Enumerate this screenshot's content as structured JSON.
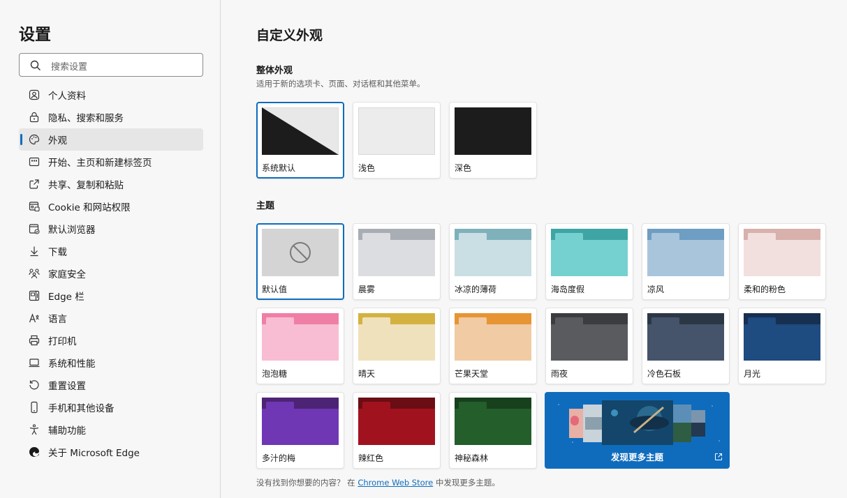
{
  "sidebar": {
    "title": "设置",
    "search_placeholder": "搜索设置",
    "items": [
      {
        "label": "个人资料",
        "icon": "profile-icon"
      },
      {
        "label": "隐私、搜索和服务",
        "icon": "lock-icon"
      },
      {
        "label": "外观",
        "icon": "palette-icon",
        "active": true
      },
      {
        "label": "开始、主页和新建标签页",
        "icon": "newtab-icon"
      },
      {
        "label": "共享、复制和粘贴",
        "icon": "share-icon"
      },
      {
        "label": "Cookie 和网站权限",
        "icon": "site-permissions-icon"
      },
      {
        "label": "默认浏览器",
        "icon": "default-browser-icon"
      },
      {
        "label": "下载",
        "icon": "download-icon"
      },
      {
        "label": "家庭安全",
        "icon": "family-icon"
      },
      {
        "label": "Edge 栏",
        "icon": "edge-bar-icon"
      },
      {
        "label": "语言",
        "icon": "language-icon"
      },
      {
        "label": "打印机",
        "icon": "printer-icon"
      },
      {
        "label": "系统和性能",
        "icon": "system-icon"
      },
      {
        "label": "重置设置",
        "icon": "reset-icon"
      },
      {
        "label": "手机和其他设备",
        "icon": "phone-icon"
      },
      {
        "label": "辅助功能",
        "icon": "accessibility-icon"
      },
      {
        "label": "关于 Microsoft Edge",
        "icon": "edge-logo-icon"
      }
    ]
  },
  "main": {
    "title": "自定义外观",
    "overall": {
      "heading": "整体外观",
      "description": "适用于新的选项卡、页面、对话框和其他菜单。",
      "options": [
        {
          "label": "系统默认",
          "selected": true
        },
        {
          "label": "浅色",
          "selected": false
        },
        {
          "label": "深色",
          "selected": false
        }
      ]
    },
    "themes": {
      "heading": "主题",
      "items": [
        {
          "label": "默认值",
          "selected": true,
          "tab": "#d4d4d4",
          "body": "#d4d4d4"
        },
        {
          "label": "晨雾",
          "tab": "#a9adb4",
          "body": "#dcdde1"
        },
        {
          "label": "冰凉的薄荷",
          "tab": "#7fb1bb",
          "body": "#c9dfe3"
        },
        {
          "label": "海岛度假",
          "tab": "#3ea5a4",
          "body": "#74d1d0"
        },
        {
          "label": "凉风",
          "tab": "#6e9ec2",
          "body": "#a9c5dc"
        },
        {
          "label": "柔和的粉色",
          "tab": "#d8b1ac",
          "body": "#f1e0de"
        },
        {
          "label": "泡泡糖",
          "tab": "#f07fa6",
          "body": "#f8bcd3"
        },
        {
          "label": "晴天",
          "tab": "#d4b242",
          "body": "#efe1bb"
        },
        {
          "label": "芒果天堂",
          "tab": "#e79434",
          "body": "#f0cba3"
        },
        {
          "label": "雨夜",
          "tab": "#3b3c3f",
          "body": "#5a5b5f"
        },
        {
          "label": "冷色石板",
          "tab": "#2c3746",
          "body": "#45546a"
        },
        {
          "label": "月光",
          "tab": "#172f50",
          "body": "#1e4b80"
        },
        {
          "label": "多汁的梅",
          "tab": "#4d2475",
          "body": "#6f37b4"
        },
        {
          "label": "辣红色",
          "tab": "#6b0d14",
          "body": "#a0131e"
        },
        {
          "label": "神秘森林",
          "tab": "#17401d",
          "body": "#235e2b"
        }
      ],
      "discover_label": "发现更多主题"
    },
    "footer": {
      "prefix": "没有找到你想要的内容？ 在",
      "link": "Chrome Web Store",
      "suffix": "中发现更多主题。"
    }
  },
  "colors": {
    "accent": "#0f6cbd",
    "background": "#f7f7f7"
  }
}
